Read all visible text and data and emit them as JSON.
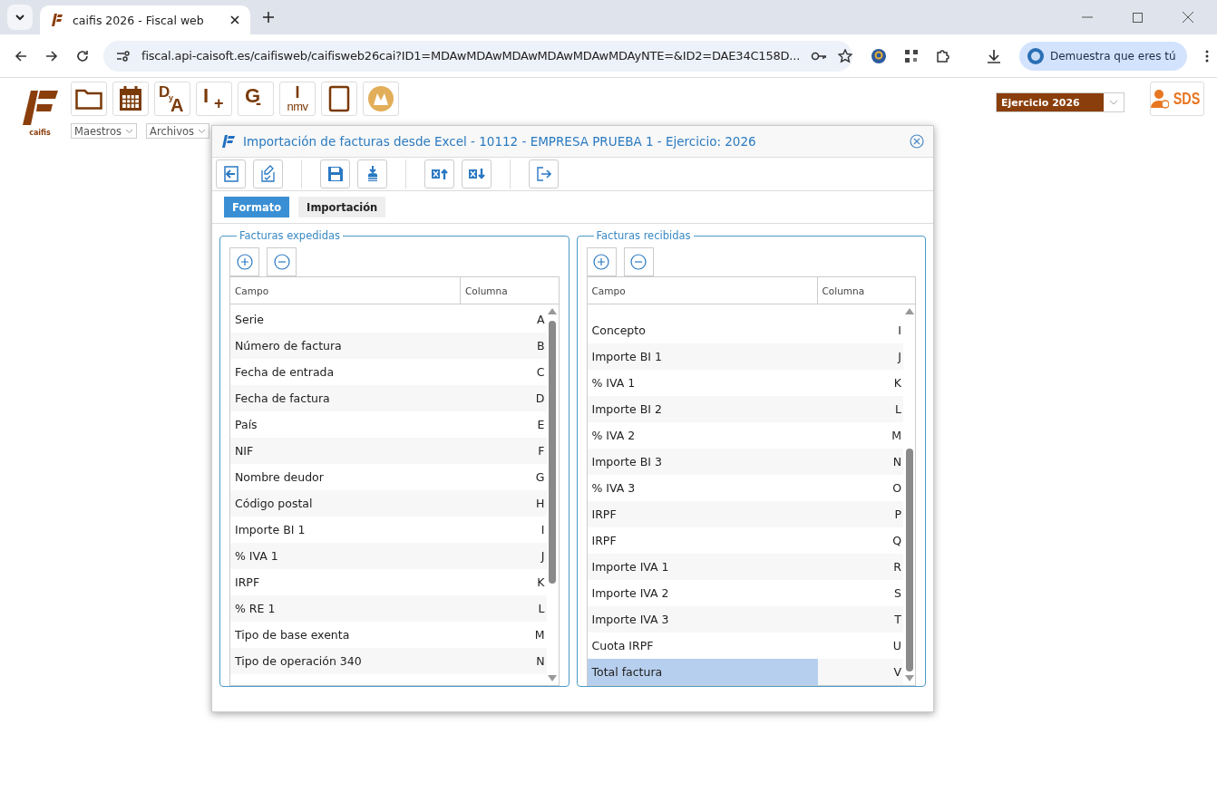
{
  "browser": {
    "tab_title": "caifis 2026 - Fiscal web",
    "url": "fiscal.api-caisoft.es/caifisweb/caifisweb26cai?ID1=MDAwMDAwMDAwMDAwMDAwMDAyNTE=&ID2=DAE34C158D...",
    "profile_button": "Demuestra que eres tú"
  },
  "app": {
    "logo_text": "caifis",
    "toolbar": [
      {
        "kind": "folder"
      },
      {
        "kind": "calendar"
      },
      {
        "kind": "da",
        "big": "D",
        "small": "y",
        "big2": "A"
      },
      {
        "kind": "sub",
        "big": "I",
        "small": "+"
      },
      {
        "kind": "sub",
        "big": "G",
        "small": "-"
      },
      {
        "kind": "stack",
        "big": "I",
        "small": "nmv"
      },
      {
        "kind": "page"
      },
      {
        "kind": "m-logo"
      }
    ],
    "menus": [
      "Maestros",
      "Archivos"
    ],
    "exercise": "Ejercicio 2026",
    "user_button": "SDS"
  },
  "dialog": {
    "title": "Importación de facturas desde Excel - 10112 - EMPRESA PRUEBA 1 - Ejercicio: 2026",
    "toolbar": [
      {
        "kind": "back"
      },
      {
        "kind": "edit"
      },
      {
        "kind": "gap"
      },
      {
        "kind": "save"
      },
      {
        "kind": "db"
      },
      {
        "kind": "gap"
      },
      {
        "kind": "excel-up"
      },
      {
        "kind": "excel-down"
      },
      {
        "kind": "gap"
      },
      {
        "kind": "exit"
      }
    ],
    "tabs": [
      {
        "label": "Formato",
        "selected": true
      },
      {
        "label": "Importación",
        "selected": false
      }
    ],
    "panels": [
      {
        "title": "Facturas expedidas",
        "columns": [
          "Campo",
          "Columna"
        ],
        "rows": [
          {
            "campo": "Serie",
            "columna": "A",
            "selected": false
          },
          {
            "campo": "Número de factura",
            "columna": "B",
            "selected": false
          },
          {
            "campo": "Fecha de entrada",
            "columna": "C",
            "selected": false
          },
          {
            "campo": "Fecha de factura",
            "columna": "D",
            "selected": false
          },
          {
            "campo": "País",
            "columna": "E",
            "selected": false
          },
          {
            "campo": "NIF",
            "columna": "F",
            "selected": false
          },
          {
            "campo": "Nombre deudor",
            "columna": "G",
            "selected": false
          },
          {
            "campo": "Código postal",
            "columna": "H",
            "selected": false
          },
          {
            "campo": "Importe BI 1",
            "columna": "I",
            "selected": false
          },
          {
            "campo": "% IVA 1",
            "columna": "J",
            "selected": false
          },
          {
            "campo": "IRPF",
            "columna": "K",
            "selected": false
          },
          {
            "campo": "% RE 1",
            "columna": "L",
            "selected": false
          },
          {
            "campo": "Tipo de base exenta",
            "columna": "M",
            "selected": false
          },
          {
            "campo": "Tipo de operación 340",
            "columna": "N",
            "selected": false
          }
        ]
      },
      {
        "title": "Facturas recibidas",
        "columns": [
          "Campo",
          "Columna"
        ],
        "rows": [
          {
            "campo": "Concepto",
            "columna": "I",
            "selected": false
          },
          {
            "campo": "Importe BI 1",
            "columna": "J",
            "selected": false
          },
          {
            "campo": "% IVA 1",
            "columna": "K",
            "selected": false
          },
          {
            "campo": "Importe BI 2",
            "columna": "L",
            "selected": false
          },
          {
            "campo": "% IVA 2",
            "columna": "M",
            "selected": false
          },
          {
            "campo": "Importe BI 3",
            "columna": "N",
            "selected": false
          },
          {
            "campo": "% IVA 3",
            "columna": "O",
            "selected": false
          },
          {
            "campo": "IRPF",
            "columna": "P",
            "selected": false
          },
          {
            "campo": "IRPF",
            "columna": "Q",
            "selected": false
          },
          {
            "campo": "Importe IVA 1",
            "columna": "R",
            "selected": false
          },
          {
            "campo": "Importe IVA 2",
            "columna": "S",
            "selected": false
          },
          {
            "campo": "Importe IVA 3",
            "columna": "T",
            "selected": false
          },
          {
            "campo": "Cuota IRPF",
            "columna": "U",
            "selected": false
          },
          {
            "campo": "Total factura",
            "columna": "V",
            "selected": true
          }
        ]
      }
    ]
  }
}
